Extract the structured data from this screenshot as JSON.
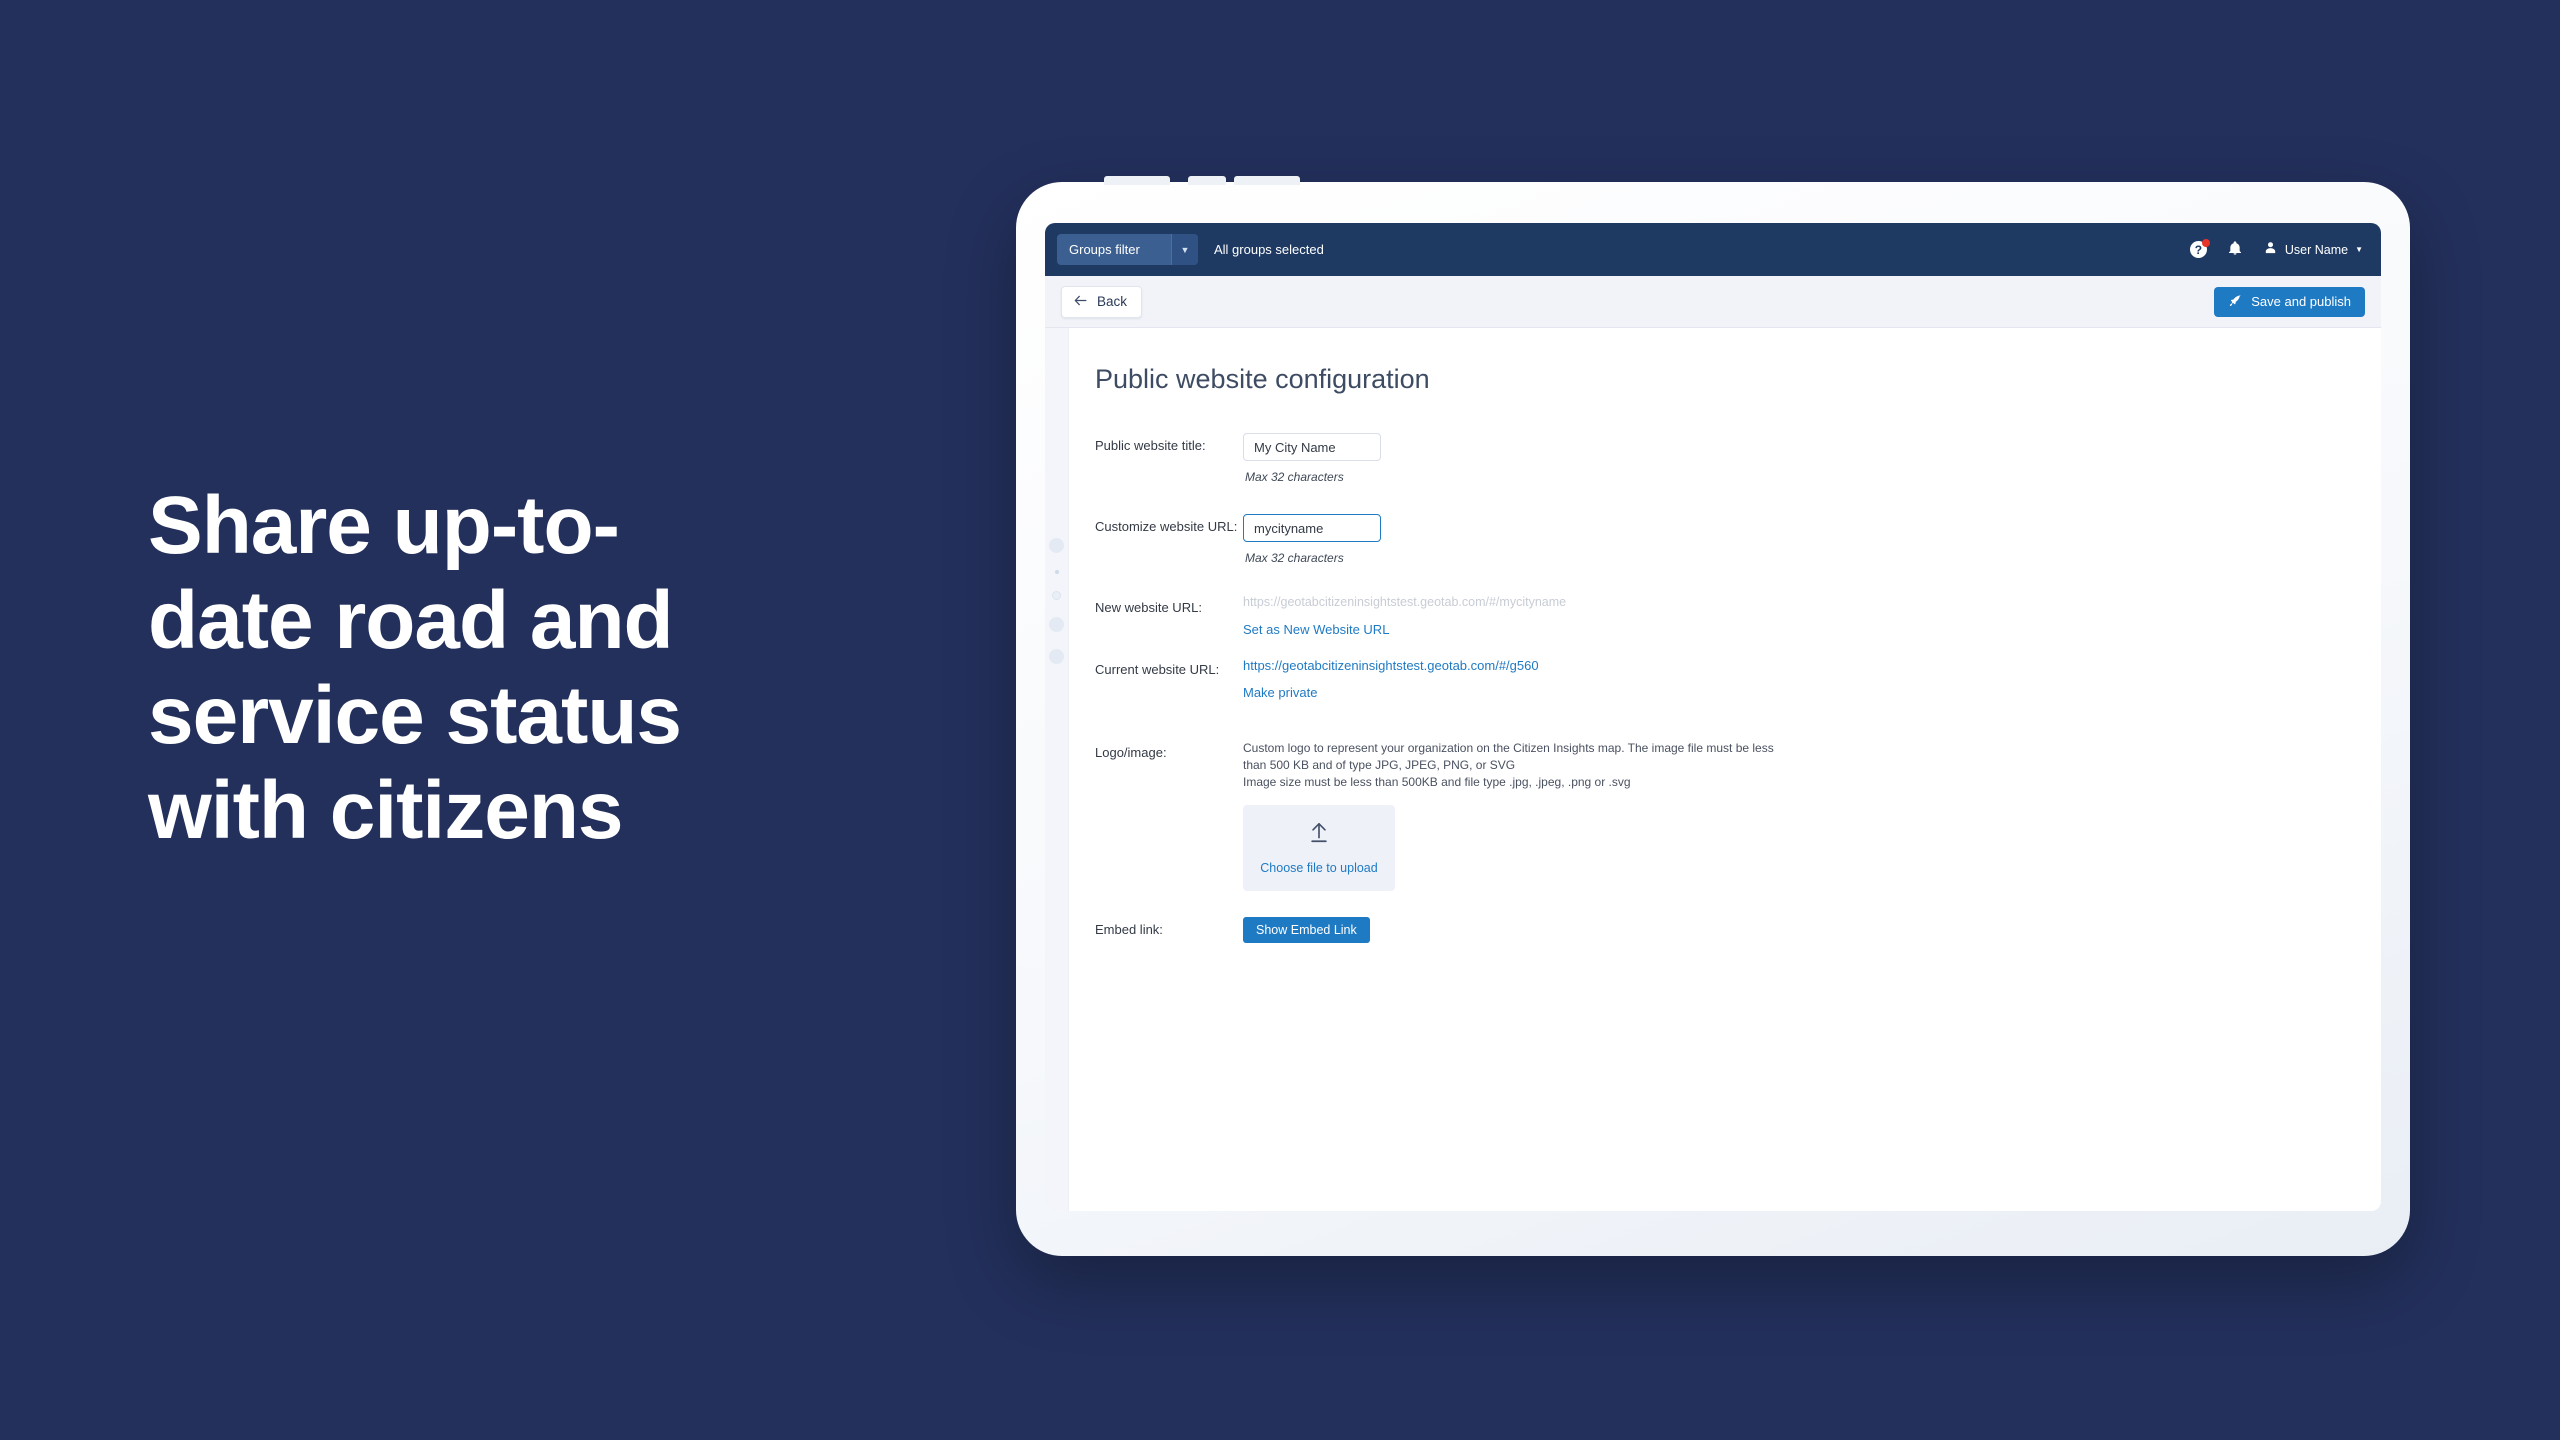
{
  "promo": {
    "headline": "Share up-to-\ndate road and\nservice status\nwith citizens"
  },
  "colors": {
    "background": "#23305c",
    "app_header": "#1e3a63",
    "accent_blue": "#1f7ac4",
    "toolbar_bg": "#f2f3f9",
    "notification_dot": "#e8342a"
  },
  "app": {
    "header": {
      "groups_filter_label": "Groups filter",
      "groups_filter_caret": "▼",
      "groups_selected": "All groups selected",
      "help_icon": "?",
      "help_icon_name": "help-icon",
      "bell_icon": "ὑ4",
      "user_name": "User Name",
      "user_caret": "▼"
    },
    "toolbar": {
      "back_label": "Back",
      "back_arrow": "←",
      "publish_label": "Save and publish",
      "rocket_icon": "rocket-icon"
    },
    "page": {
      "title": "Public website configuration",
      "fields": {
        "website_title": {
          "label": "Public website title:",
          "value": "My City Name",
          "hint": "Max 32 characters"
        },
        "customize_url": {
          "label": "Customize website URL:",
          "value": "mycityname",
          "hint": "Max 32 characters"
        },
        "new_url": {
          "label": "New website URL:",
          "value": "https://geotabcitizeninsightstest.geotab.com/#/mycityname",
          "action": "Set as New Website URL"
        },
        "current_url": {
          "label": "Current website URL:",
          "value": "https://geotabcitizeninsightstest.geotab.com/#/g560",
          "action": "Make private"
        },
        "logo": {
          "label": "Logo/image:",
          "description_line1": "Custom logo to represent your organization on the Citizen Insights map. The image file must be less",
          "description_line2": "than 500 KB and of type JPG, JPEG, PNG, or SVG",
          "description_line3": "Image size must be less than 500KB and file type .jpg, .jpeg, .png or .svg",
          "upload_label": "Choose file to upload",
          "upload_icon": "upload-arrow-icon"
        },
        "embed": {
          "label": "Embed link:",
          "button_label": "Show Embed Link"
        }
      }
    }
  }
}
